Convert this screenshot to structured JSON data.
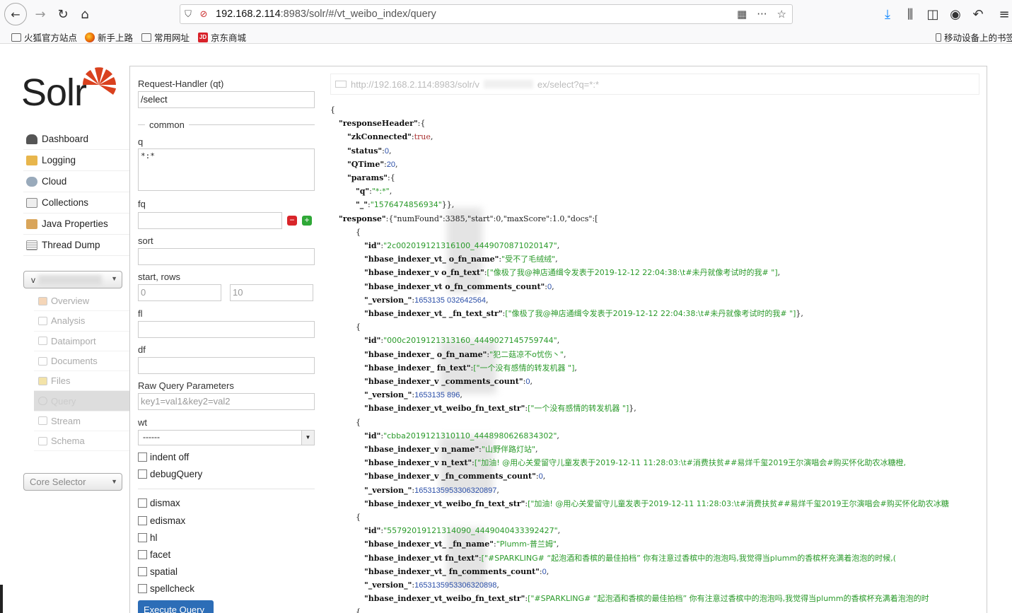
{
  "browser": {
    "url_host": "192.168.2.114",
    "url_path": ":8983/solr/#/vt_weibo_index/query",
    "bookmarks": [
      "火狐官方站点",
      "新手上路",
      "常用网址",
      "京东商城"
    ],
    "mobile_bookmarks": "移动设备上的书签",
    "icons": [
      "back-icon",
      "forward-icon",
      "reload-icon",
      "home-icon",
      "shield-icon",
      "insecure-lock-icon",
      "qr-icon",
      "more-icon",
      "star-icon",
      "download-icon",
      "library-icon",
      "sidebar-icon",
      "account-icon",
      "undo-icon",
      "menu-icon"
    ]
  },
  "solr": {
    "logo": "Solr",
    "nav": [
      "Dashboard",
      "Logging",
      "Cloud",
      "Collections",
      "Java Properties",
      "Thread Dump"
    ],
    "core_selected": "v",
    "sub_nav": [
      "Overview",
      "Analysis",
      "Dataimport",
      "Documents",
      "Files",
      "Query",
      "Stream",
      "Schema"
    ],
    "active_sub": "Query",
    "core_selector": "Core Selector"
  },
  "form": {
    "request_handler_label": "Request-Handler (qt)",
    "request_handler": "/select",
    "common_label": "common",
    "q_label": "q",
    "q_value": "*:*",
    "fq_label": "fq",
    "sort_label": "sort",
    "start_rows_label": "start, rows",
    "start_placeholder": "0",
    "rows_placeholder": "10",
    "fl_label": "fl",
    "df_label": "df",
    "raw_label": "Raw Query Parameters",
    "raw_placeholder": "key1=val1&key2=val2",
    "wt_label": "wt",
    "wt_value": "------",
    "indent_off": "indent off",
    "debug_query": "debugQuery",
    "options": [
      "dismax",
      "edismax",
      "hl",
      "facet",
      "spatial",
      "spellcheck"
    ],
    "execute": "Execute Query"
  },
  "response": {
    "request_url": "http://192.168.2.114:8983/solr/v",
    "request_url_tail": "ex/select?q=*:*",
    "lines": [
      {
        "i": 0,
        "t": "{"
      },
      {
        "i": 1,
        "k": "responseHeader",
        "t": ":{"
      },
      {
        "i": 2,
        "k": "zkConnected",
        "b": "true",
        "t": ","
      },
      {
        "i": 2,
        "k": "status",
        "n": "0",
        "t": ","
      },
      {
        "i": 2,
        "k": "QTime",
        "n": "20",
        "t": ","
      },
      {
        "i": 2,
        "k": "params",
        "t": ":{"
      },
      {
        "i": 3,
        "k": "q",
        "s": "\"*:*\"",
        "t": ","
      },
      {
        "i": 3,
        "k": "_",
        "s": "\"1576474856934\"",
        "t": "}},"
      },
      {
        "i": 1,
        "k": "response",
        "t": ":{\"numFound\":3385,\"start\":0,\"maxScore\":1.0,\"docs\":["
      },
      {
        "i": 3,
        "t": "{"
      },
      {
        "i": 4,
        "k": "id",
        "s": "\"2c002019121316100_4449070871020147\"",
        "t": ","
      },
      {
        "i": 4,
        "k": "hbase_indexer_vt_          o_fn_name",
        "s": "\"受不了毛绒绒\"",
        "t": ","
      },
      {
        "i": 4,
        "k": "hbase_indexer_v          o_fn_text",
        "s": "[\"像极了我@神店通缉令发表于2019-12-12 22:04:38:\\t#未丹就像考试时的我#  \"]",
        "t": ","
      },
      {
        "i": 4,
        "k": "hbase_indexer_vt          o_fn_comments_count",
        "n": "0",
        "t": ","
      },
      {
        "i": 4,
        "k": "_version_",
        "n": "1653135         032642564",
        "t": ","
      },
      {
        "i": 4,
        "k": "hbase_indexer_vt_        _fn_text_str",
        "s": "[\"像极了我@神店通缉令发表于2019-12-12 22:04:38:\\t#未丹就像考试时的我#  \"]",
        "t": "},"
      },
      {
        "i": 3,
        "t": "{"
      },
      {
        "i": 4,
        "k": "id",
        "s": "\"000c2019121313160_4449027145759744\"",
        "t": ","
      },
      {
        "i": 4,
        "k": "hbase_indexer_          o_fn_name",
        "s": "\"犯二菇凉不o忧伤丶\"",
        "t": ","
      },
      {
        "i": 4,
        "k": "hbase_indexer_          fn_text",
        "s": "[\"一个没有感情的转发机器  \"]",
        "t": ","
      },
      {
        "i": 4,
        "k": "hbase_indexer_v          _comments_count",
        "n": "0",
        "t": ","
      },
      {
        "i": 4,
        "k": "_version_",
        "n": "1653135          896",
        "t": ","
      },
      {
        "i": 4,
        "k": "hbase_indexer_vt_weibo_fn_text_str",
        "s": "[\"一个没有感情的转发机器  \"]",
        "t": "},"
      },
      {
        "i": 3,
        "t": "{"
      },
      {
        "i": 4,
        "k": "id",
        "s": "\"cbba2019121310110_4448980626834302\"",
        "t": ","
      },
      {
        "i": 4,
        "k": "hbase_indexer_v          n_name",
        "s": "\"山野伴路灯站\"",
        "t": ","
      },
      {
        "i": 4,
        "k": "hbase_indexer_v          n_text",
        "s": "[\"加油! @用心关爱留守儿童发表于2019-12-11 11:28:03:\\t#消费扶贫##易烊千玺2019王尔演唱会#购买怀化助农冰糖橙,",
        "t": ""
      },
      {
        "i": 4,
        "k": "hbase_indexer_v          _fn_comments_count",
        "n": "0",
        "t": ","
      },
      {
        "i": 4,
        "k": "_version_",
        "n": "1653135953306320897",
        "t": ","
      },
      {
        "i": 4,
        "k": "hbase_indexer_vt_weibo_fn_text_str",
        "s": "[\"加油! @用心关爱留守儿童发表于2019-12-11 11:28:03:\\t#消费扶贫##易烊千玺2019王尔演唱会#购买怀化助农冰糖",
        "t": ""
      },
      {
        "i": 3,
        "t": "{"
      },
      {
        "i": 4,
        "k": "id",
        "s": "\"55792019121314090_4449040433392427\"",
        "t": ","
      },
      {
        "i": 4,
        "k": "hbase_indexer_vt_          _fn_name",
        "s": "\"Plumm-普兰姆\"",
        "t": ","
      },
      {
        "i": 4,
        "k": "hbase_indexer_vt          fn_text",
        "s": "[\"#SPARKLING# “起泡酒和香槟的最佳拍档” 你有注意过香槟中的泡泡吗,我觉得当plumm的香槟杯充满着泡泡的时候,(",
        "t": ""
      },
      {
        "i": 4,
        "k": "hbase_indexer_vt_          fn_comments_count",
        "n": "0",
        "t": ","
      },
      {
        "i": 4,
        "k": "_version_",
        "n": "1653135953306320898",
        "t": ","
      },
      {
        "i": 4,
        "k": "hbase_indexer_vt_weibo_fn_text_str",
        "s": "[\"#SPARKLING# “起泡酒和香槟的最佳拍档” 你有注意过香槟中的泡泡吗,我觉得当plumm的香槟杯充满着泡泡的时",
        "t": ""
      },
      {
        "i": 3,
        "t": "{"
      }
    ]
  }
}
